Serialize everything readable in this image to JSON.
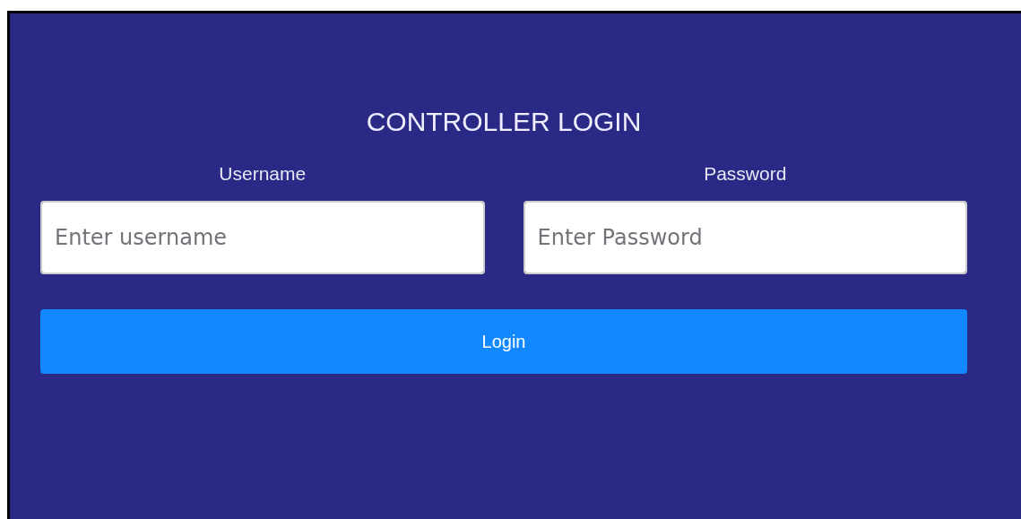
{
  "title": "CONTROLLER LOGIN",
  "fields": [
    {
      "label": "Username",
      "placeholder": "Enter username"
    },
    {
      "label": "Password",
      "placeholder": "Enter Password"
    }
  ],
  "button": "Login"
}
